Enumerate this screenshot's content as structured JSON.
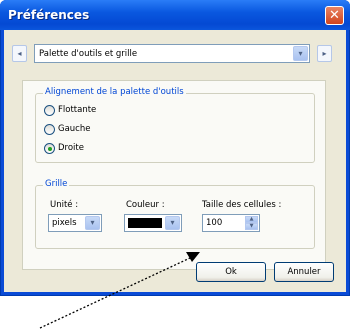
{
  "window": {
    "title": "Préférences",
    "close_glyph": "✕"
  },
  "nav": {
    "prev_glyph": "◂",
    "next_glyph": "▸",
    "dropdown_glyph": "▾",
    "section_value": "Palette d'outils et grille"
  },
  "alignment": {
    "legend": "Alignement de la palette d'outils",
    "options": [
      {
        "label": "Flottante",
        "selected": false
      },
      {
        "label": "Gauche",
        "selected": false
      },
      {
        "label": "Droite",
        "selected": true
      }
    ]
  },
  "grid": {
    "legend": "Grille",
    "unit_label": "Unité :",
    "unit_value": "pixels",
    "color_label": "Couleur :",
    "color_value": "#000000",
    "cell_size_label": "Taille des cellules :",
    "cell_size_value": "100",
    "spin_up": "▲",
    "spin_down": "▼"
  },
  "buttons": {
    "ok": "Ok",
    "cancel": "Annuler"
  },
  "colors": {
    "title_bar": "#0a58e0",
    "legend_text": "#0046d5",
    "radio_selected": "#21a121",
    "annotation_arrow": "#000000"
  },
  "icons": [
    "close-icon",
    "prev-arrow-icon",
    "next-arrow-icon",
    "chevron-down-icon",
    "spin-up-icon",
    "spin-down-icon",
    "annotation-arrow"
  ]
}
